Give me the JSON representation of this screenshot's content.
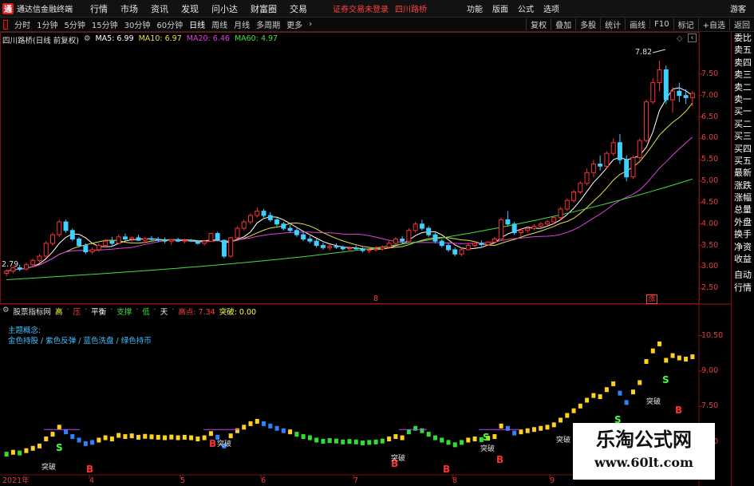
{
  "app": {
    "title": "通达信金融终端",
    "menu": [
      "行情",
      "市场",
      "资讯",
      "发现",
      "问小达",
      "财富圈",
      "交易"
    ],
    "broker_status": "证券交易未登录",
    "stock_name": "四川路桥",
    "right_menu": [
      "功能",
      "版面",
      "公式",
      "选项"
    ],
    "guest": "游客"
  },
  "toolbar": {
    "periods": [
      "分时",
      "1分钟",
      "5分钟",
      "15分钟",
      "30分钟",
      "60分钟",
      "日线",
      "周线",
      "月线",
      "多周期",
      "更多"
    ],
    "active_period": "日线",
    "tools": [
      "复权",
      "叠加",
      "多股",
      "统计",
      "画线",
      "F10",
      "标记",
      "+自选",
      "返回"
    ]
  },
  "side_panel": [
    "委比",
    "卖五",
    "卖四",
    "卖三",
    "卖二",
    "卖一",
    "买一",
    "买二",
    "买三",
    "买四",
    "买五",
    "最新",
    "涨跌",
    "涨幅",
    "总量",
    "外盘",
    "换手",
    "净资",
    "收益",
    "自动",
    "行情"
  ],
  "main_panel": {
    "title": "四川路桥(日线 前复权)",
    "ma": [
      {
        "label": "MA5: 6.99",
        "color": "#ffffff"
      },
      {
        "label": "MA10: 6.97",
        "color": "#e8e040"
      },
      {
        "label": "MA20: 6.46",
        "color": "#e040e0"
      },
      {
        "label": "MA60: 4.97",
        "color": "#40e040"
      }
    ],
    "y_ticks": [
      "7.50",
      "7.00",
      "6.50",
      "6.00",
      "5.50",
      "5.00",
      "4.50",
      "4.00",
      "3.50",
      "3.00",
      "2.50"
    ],
    "high_label": "7.82",
    "low_label": "2.79",
    "marker_1": "8",
    "marker_2": "涨"
  },
  "sub_panel": {
    "title": "股票指标网",
    "legend": [
      {
        "label": "高",
        "color": "#ffff40"
      },
      {
        "label": "压",
        "color": "#ff4040"
      },
      {
        "label": "平衡",
        "color": "#ffffff"
      },
      {
        "label": "支撑",
        "color": "#40e040"
      },
      {
        "label": "低",
        "color": "#40e040"
      },
      {
        "label": "天",
        "color": "#ffffff"
      },
      {
        "label": "高点: 7.34",
        "color": "#ff4040"
      },
      {
        "label": "突破: 0.00",
        "color": "#ffff40"
      }
    ],
    "theme_title": "主题概念:",
    "theme_items": "金色持股 / 紫色反弹 / 蓝色洗盘 / 绿色持币",
    "y_ticks": [
      "10.50",
      "9.00",
      "7.50",
      "6.00"
    ],
    "buy_mark": "B",
    "sell_mark": "S",
    "tag_text": "突破",
    "start_date": "2021年"
  },
  "x_axis": [
    "4",
    "5",
    "6",
    "7",
    "8",
    "9"
  ],
  "watermark": {
    "title": "乐淘公式网",
    "url": "www.60lt.com"
  },
  "chart_data": {
    "type": "candlestick",
    "title": "四川路桥(日线 前复权)",
    "x": [
      "2021年",
      "4",
      "5",
      "6",
      "7",
      "8",
      "9"
    ],
    "ylim": [
      2.3,
      8.0
    ],
    "ohlc_approx": [
      [
        2.85,
        2.95,
        2.78,
        2.9
      ],
      [
        2.9,
        3.0,
        2.85,
        2.98
      ],
      [
        2.98,
        3.05,
        2.9,
        2.95
      ],
      [
        2.95,
        3.1,
        2.92,
        3.05
      ],
      [
        3.05,
        3.2,
        3.0,
        3.15
      ],
      [
        3.15,
        3.3,
        3.1,
        3.25
      ],
      [
        3.25,
        3.6,
        3.2,
        3.55
      ],
      [
        3.55,
        3.8,
        3.5,
        3.75
      ],
      [
        3.75,
        4.1,
        3.7,
        4.05
      ],
      [
        4.05,
        4.1,
        3.8,
        3.85
      ],
      [
        3.85,
        3.9,
        3.6,
        3.65
      ],
      [
        3.65,
        3.7,
        3.45,
        3.5
      ],
      [
        3.5,
        3.55,
        3.3,
        3.35
      ],
      [
        3.35,
        3.45,
        3.3,
        3.4
      ],
      [
        3.4,
        3.55,
        3.35,
        3.5
      ],
      [
        3.5,
        3.65,
        3.45,
        3.6
      ],
      [
        3.6,
        3.7,
        3.5,
        3.55
      ],
      [
        3.55,
        3.75,
        3.52,
        3.7
      ],
      [
        3.7,
        3.78,
        3.6,
        3.65
      ],
      [
        3.65,
        3.72,
        3.58,
        3.68
      ],
      [
        3.68,
        3.75,
        3.6,
        3.62
      ],
      [
        3.62,
        3.7,
        3.55,
        3.66
      ],
      [
        3.66,
        3.72,
        3.6,
        3.64
      ],
      [
        3.64,
        3.7,
        3.58,
        3.62
      ],
      [
        3.62,
        3.68,
        3.55,
        3.6
      ],
      [
        3.6,
        3.65,
        3.52,
        3.63
      ],
      [
        3.63,
        3.68,
        3.58,
        3.6
      ],
      [
        3.6,
        3.66,
        3.55,
        3.62
      ],
      [
        3.62,
        3.65,
        3.58,
        3.6
      ],
      [
        3.6,
        3.62,
        3.52,
        3.55
      ],
      [
        3.55,
        3.62,
        3.5,
        3.6
      ],
      [
        3.6,
        3.8,
        3.58,
        3.78
      ],
      [
        3.78,
        3.82,
        3.6,
        3.62
      ],
      [
        3.62,
        3.64,
        3.2,
        3.25
      ],
      [
        3.25,
        3.7,
        3.22,
        3.68
      ],
      [
        3.68,
        3.95,
        3.65,
        3.9
      ],
      [
        3.9,
        4.1,
        3.85,
        4.05
      ],
      [
        4.05,
        4.25,
        4.0,
        4.2
      ],
      [
        4.2,
        4.38,
        4.15,
        4.3
      ],
      [
        4.3,
        4.35,
        4.15,
        4.2
      ],
      [
        4.2,
        4.28,
        4.05,
        4.1
      ],
      [
        4.1,
        4.15,
        3.95,
        4.0
      ],
      [
        4.0,
        4.05,
        3.85,
        3.9
      ],
      [
        3.9,
        3.98,
        3.8,
        3.85
      ],
      [
        3.85,
        3.9,
        3.7,
        3.75
      ],
      [
        3.75,
        3.8,
        3.6,
        3.65
      ],
      [
        3.65,
        3.72,
        3.55,
        3.6
      ],
      [
        3.6,
        3.65,
        3.45,
        3.5
      ],
      [
        3.5,
        3.56,
        3.4,
        3.45
      ],
      [
        3.45,
        3.52,
        3.38,
        3.48
      ],
      [
        3.48,
        3.55,
        3.42,
        3.46
      ],
      [
        3.46,
        3.5,
        3.38,
        3.42
      ],
      [
        3.42,
        3.48,
        3.36,
        3.44
      ],
      [
        3.44,
        3.5,
        3.4,
        3.42
      ],
      [
        3.42,
        3.46,
        3.34,
        3.38
      ],
      [
        3.38,
        3.44,
        3.32,
        3.4
      ],
      [
        3.4,
        3.48,
        3.36,
        3.42
      ],
      [
        3.42,
        3.5,
        3.38,
        3.46
      ],
      [
        3.46,
        3.6,
        3.42,
        3.55
      ],
      [
        3.55,
        3.7,
        3.5,
        3.65
      ],
      [
        3.65,
        3.72,
        3.55,
        3.6
      ],
      [
        3.6,
        3.9,
        3.58,
        3.85
      ],
      [
        3.85,
        4.05,
        3.8,
        4.0
      ],
      [
        4.0,
        4.1,
        3.85,
        3.9
      ],
      [
        3.9,
        3.95,
        3.7,
        3.75
      ],
      [
        3.75,
        3.8,
        3.55,
        3.6
      ],
      [
        3.6,
        3.65,
        3.45,
        3.5
      ],
      [
        3.5,
        3.55,
        3.35,
        3.4
      ],
      [
        3.4,
        3.45,
        3.25,
        3.3
      ],
      [
        3.3,
        3.45,
        3.25,
        3.4
      ],
      [
        3.4,
        3.55,
        3.38,
        3.5
      ],
      [
        3.5,
        3.6,
        3.45,
        3.55
      ],
      [
        3.55,
        3.62,
        3.48,
        3.52
      ],
      [
        3.52,
        3.6,
        3.5,
        3.58
      ],
      [
        3.58,
        3.7,
        3.55,
        3.65
      ],
      [
        3.65,
        4.15,
        3.62,
        4.1
      ],
      [
        4.1,
        4.3,
        3.95,
        4.0
      ],
      [
        4.0,
        4.05,
        3.75,
        3.8
      ],
      [
        3.8,
        3.9,
        3.72,
        3.85
      ],
      [
        3.85,
        3.95,
        3.8,
        3.9
      ],
      [
        3.9,
        4.0,
        3.85,
        3.95
      ],
      [
        3.95,
        4.05,
        3.9,
        4.0
      ],
      [
        4.0,
        4.1,
        3.95,
        4.05
      ],
      [
        4.05,
        4.2,
        4.0,
        4.15
      ],
      [
        4.15,
        4.4,
        4.1,
        4.35
      ],
      [
        4.35,
        4.6,
        4.3,
        4.55
      ],
      [
        4.55,
        4.8,
        4.5,
        4.75
      ],
      [
        4.75,
        5.0,
        4.7,
        4.95
      ],
      [
        4.95,
        5.3,
        4.9,
        5.2
      ],
      [
        5.2,
        5.5,
        5.1,
        5.4
      ],
      [
        5.4,
        5.6,
        5.25,
        5.35
      ],
      [
        5.35,
        5.7,
        5.3,
        5.65
      ],
      [
        5.65,
        6.0,
        5.6,
        5.9
      ],
      [
        5.9,
        6.1,
        5.4,
        5.5
      ],
      [
        5.5,
        5.6,
        5.0,
        5.1
      ],
      [
        5.1,
        5.6,
        5.05,
        5.55
      ],
      [
        5.55,
        6.0,
        5.5,
        5.95
      ],
      [
        5.95,
        6.9,
        5.9,
        6.85
      ],
      [
        6.85,
        7.4,
        6.8,
        7.3
      ],
      [
        7.3,
        7.82,
        7.1,
        7.6
      ],
      [
        7.6,
        7.7,
        6.8,
        6.9
      ],
      [
        6.9,
        7.2,
        6.6,
        7.1
      ],
      [
        7.1,
        7.3,
        6.85,
        7.0
      ],
      [
        7.0,
        7.15,
        6.8,
        6.95
      ],
      [
        6.95,
        7.1,
        6.75,
        7.05
      ]
    ]
  }
}
